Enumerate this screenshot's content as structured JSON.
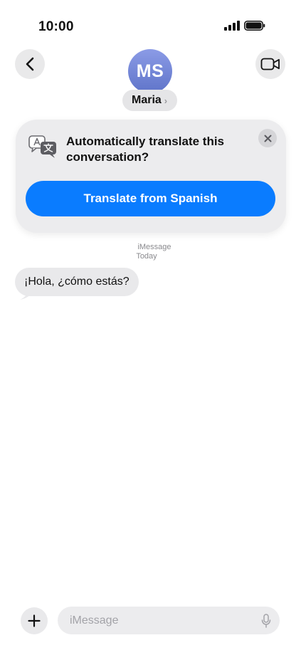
{
  "status_bar": {
    "time": "10:00"
  },
  "header": {
    "contact_initials": "MS",
    "contact_name": "Maria",
    "name_chevron": "›"
  },
  "translate_card": {
    "question": "Automatically translate this conversation?",
    "button_label": "Translate from Spanish"
  },
  "conversation": {
    "service": "iMessage",
    "day": "Today",
    "messages": [
      {
        "sender": "contact",
        "text": "¡Hola, ¿cómo estás?"
      }
    ]
  },
  "composer": {
    "placeholder": "iMessage"
  },
  "icons": {
    "back": "chevron-left-icon",
    "video": "video-camera-icon",
    "translate": "translate-icon",
    "close": "close-icon",
    "plus": "plus-icon",
    "mic": "microphone-icon"
  },
  "colors": {
    "accent": "#0a7cff",
    "bubble_incoming": "#e9e9eb",
    "card_background": "#ececee",
    "avatar_gradient_top": "#8b9be6",
    "avatar_gradient_bottom": "#5f74c9"
  }
}
